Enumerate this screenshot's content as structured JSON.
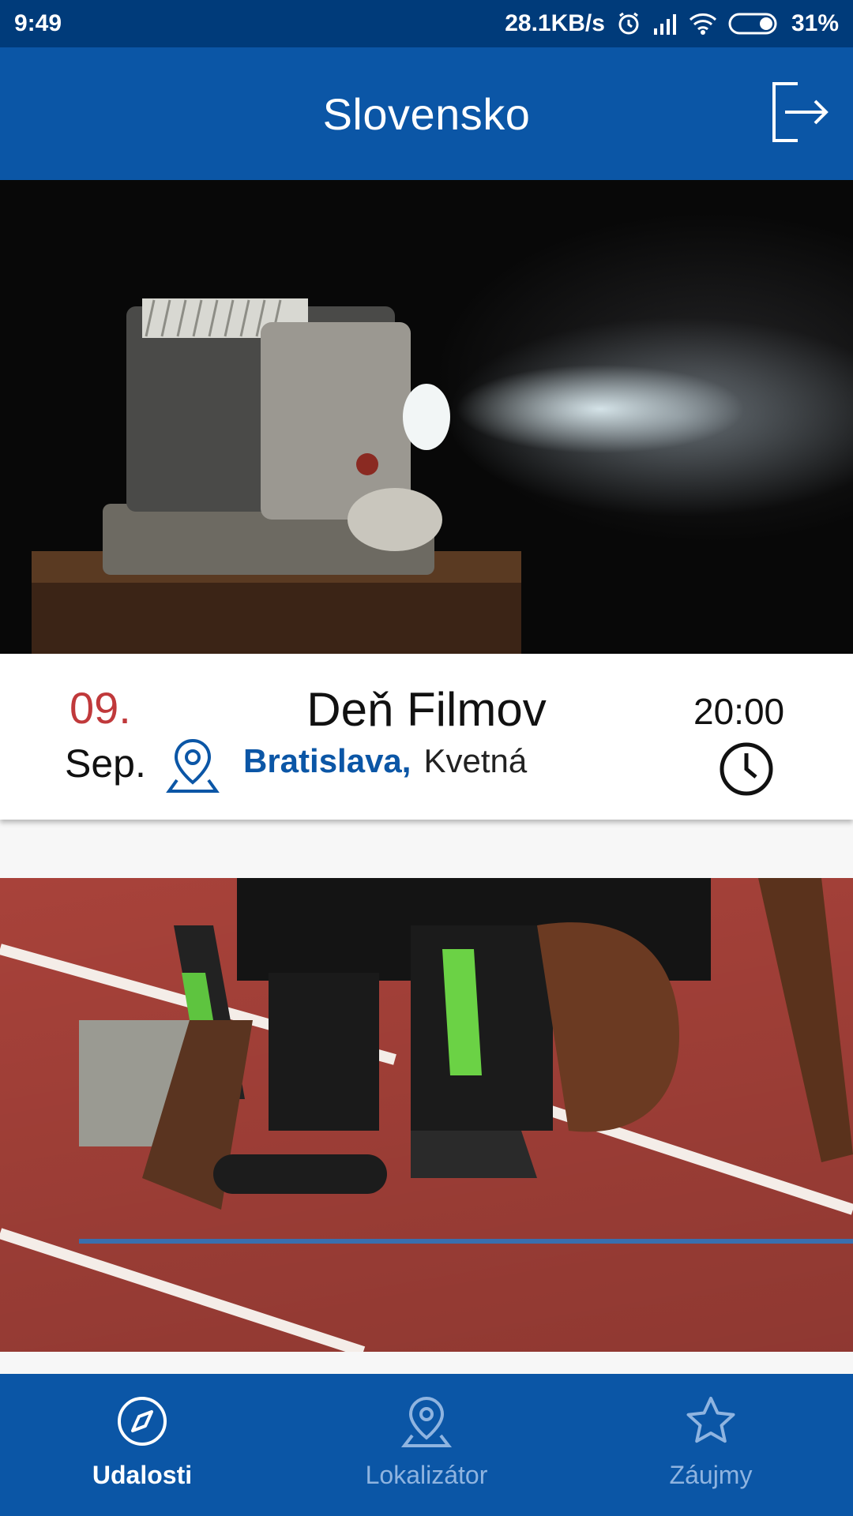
{
  "status_bar": {
    "time": "9:49",
    "network_speed": "28.1KB/s",
    "battery": "31%"
  },
  "header": {
    "title": "Slovensko"
  },
  "events": [
    {
      "day": "09.",
      "month": "Sep.",
      "title": "Deň Filmov",
      "city": "Bratislava,",
      "street": "Kvetná",
      "time": "20:00"
    }
  ],
  "bottom_nav": {
    "items": [
      {
        "label": "Udalosti",
        "icon": "compass-icon",
        "active": true
      },
      {
        "label": "Lokalizátor",
        "icon": "location-pin-icon",
        "active": false
      },
      {
        "label": "Záujmy",
        "icon": "star-icon",
        "active": false
      }
    ]
  },
  "colors": {
    "primary": "#0b56a6",
    "status_bar": "#003b7a",
    "date_accent": "#c0393b"
  }
}
